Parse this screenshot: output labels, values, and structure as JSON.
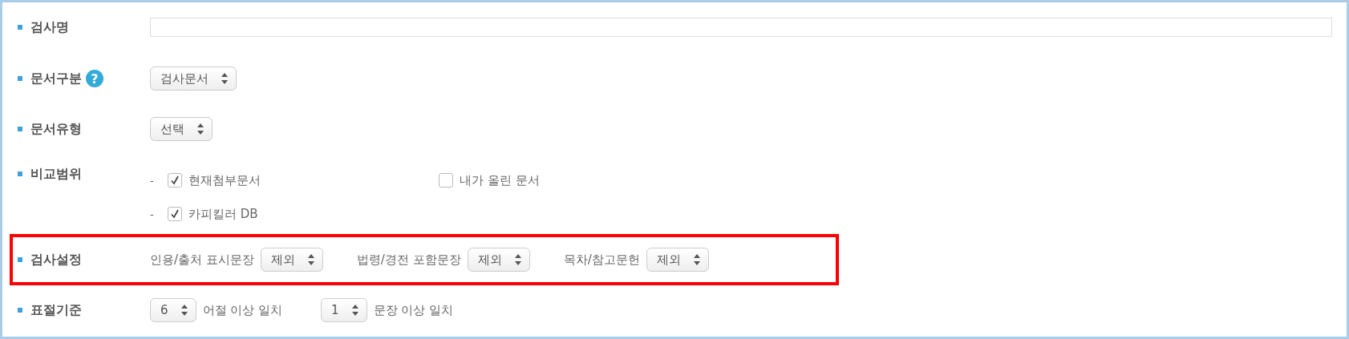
{
  "rows": [
    {
      "kind": "text",
      "label": "검사명"
    },
    {
      "kind": "select",
      "label": "문서구분",
      "help": "?",
      "value": "검사문서"
    },
    {
      "kind": "select",
      "label": "문서유형",
      "value": "선택"
    },
    {
      "kind": "checks",
      "label": "비교범위",
      "lines": [
        {
          "options": [
            {
              "label": "현재첨부문서",
              "checked": true,
              "bullet": "-"
            },
            {
              "label": "내가 올린 문서",
              "checked": false
            }
          ]
        },
        {
          "options": [
            {
              "label": "카피킬러 DB",
              "checked": true,
              "bullet": "-"
            }
          ]
        }
      ]
    },
    {
      "kind": "settings",
      "label": "검사설정",
      "highlighted": true,
      "items": [
        {
          "label": "인용/출처 표시문장",
          "value": "제외"
        },
        {
          "label": "법령/경전 포함문장",
          "value": "제외"
        },
        {
          "label": "목차/참고문헌",
          "value": "제외"
        }
      ]
    },
    {
      "kind": "criteria",
      "label": "표절기준",
      "items": [
        {
          "value": "6",
          "text": "어절 이상 일치"
        },
        {
          "value": "1",
          "text": "문장 이상 일치"
        }
      ]
    }
  ]
}
